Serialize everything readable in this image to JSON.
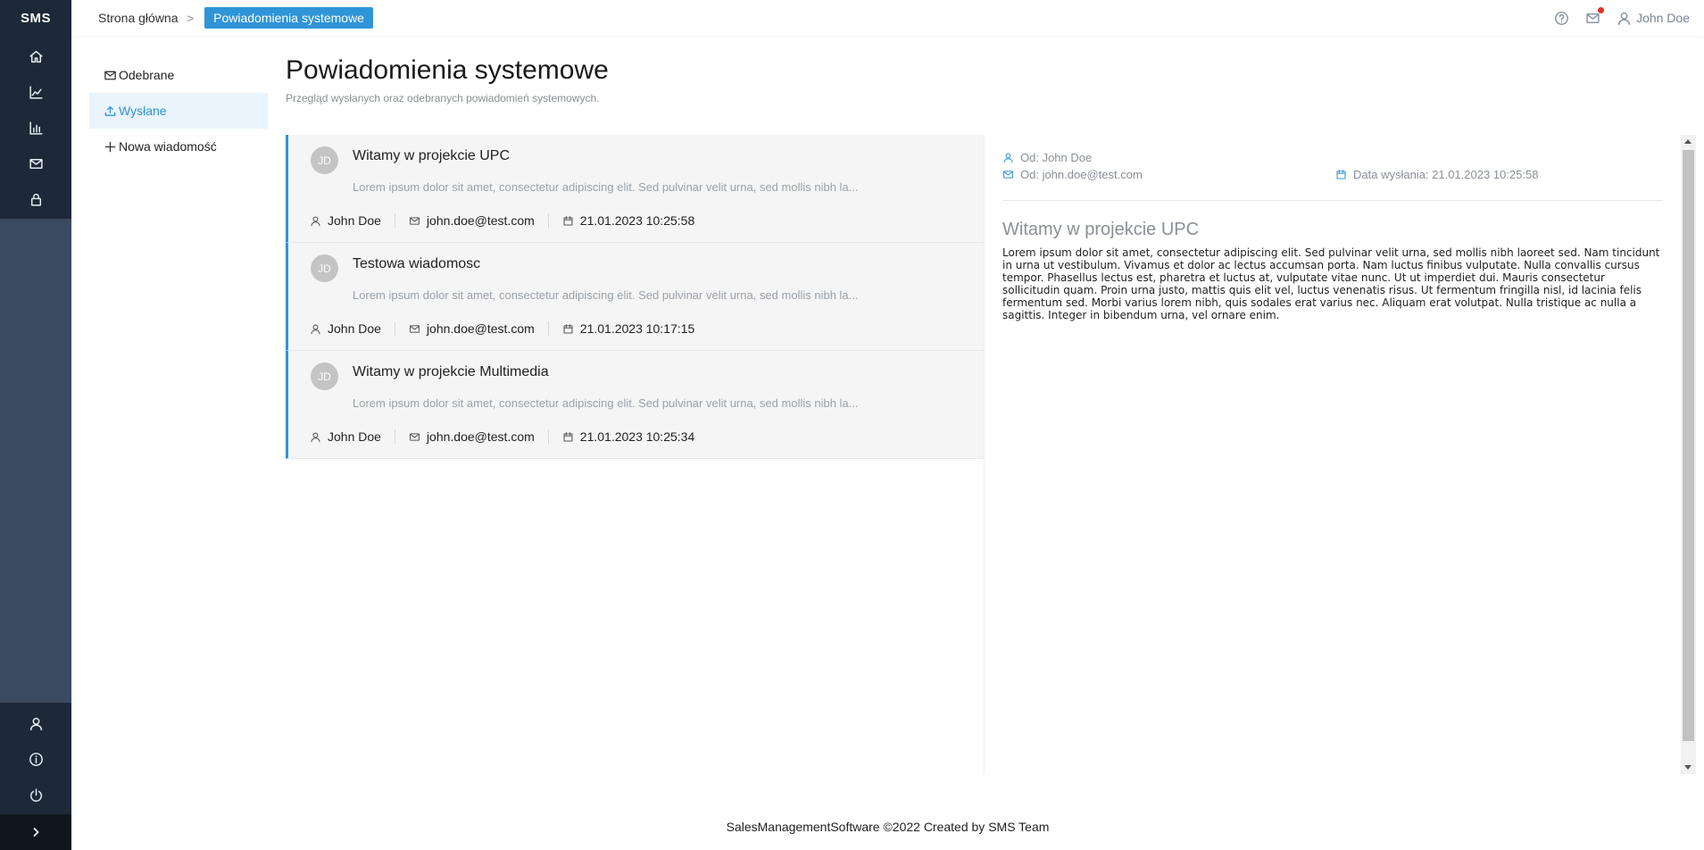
{
  "app": {
    "logo": "SMS"
  },
  "sidebar": {
    "top_icons": [
      "home-icon",
      "line-chart-icon",
      "bar-chart-icon",
      "mail-icon",
      "lock-icon"
    ],
    "bottom_icons": [
      "user-icon",
      "info-icon",
      "power-icon"
    ],
    "expand_icon": "chevron-right-icon"
  },
  "header": {
    "breadcrumb_home": "Strona główna",
    "breadcrumb_separator": ">",
    "breadcrumb_current": "Powiadomienia systemowe",
    "user_name": "John Doe",
    "notification_dot_color": "#e5302a"
  },
  "submenu": {
    "items": [
      {
        "label": "Odebrane",
        "icon": "inbox-icon",
        "active": false
      },
      {
        "label": "Wysłane",
        "icon": "upload-icon",
        "active": true
      },
      {
        "label": "Nowa wiadomość",
        "icon": "plus-icon",
        "active": false
      }
    ]
  },
  "page": {
    "title": "Powiadomienia systemowe",
    "subtitle": "Przegląd wysłanych oraz odebranych powiadomień systemowych."
  },
  "messages": [
    {
      "initials": "JD",
      "title": "Witamy w projekcie UPC",
      "preview": "Lorem ipsum dolor sit amet, consectetur adipiscing elit. Sed pulvinar velit urna, sed mollis nibh la...",
      "author": "John Doe",
      "email": "john.doe@test.com",
      "date": "21.01.2023 10:25:58"
    },
    {
      "initials": "JD",
      "title": "Testowa wiadomosc",
      "preview": "Lorem ipsum dolor sit amet, consectetur adipiscing elit. Sed pulvinar velit urna, sed mollis nibh la...",
      "author": "John Doe",
      "email": "john.doe@test.com",
      "date": "21.01.2023 10:17:15"
    },
    {
      "initials": "JD",
      "title": "Witamy w projekcie Multimedia",
      "preview": "Lorem ipsum dolor sit amet, consectetur adipiscing elit. Sed pulvinar velit urna, sed mollis nibh la...",
      "author": "John Doe",
      "email": "john.doe@test.com",
      "date": "21.01.2023 10:25:34"
    }
  ],
  "detail": {
    "from_name": "Od: John Doe",
    "from_email": "Od: john.doe@test.com",
    "sent_date": "Data wysłania: 21.01.2023 10:25:58",
    "title": "Witamy w projekcie UPC",
    "body": "Lorem ipsum dolor sit amet, consectetur adipiscing elit. Sed pulvinar velit urna, sed mollis nibh laoreet sed. Nam tincidunt in urna ut vestibulum. Vivamus et dolor ac lectus accumsan porta. Nam luctus finibus vulputate. Nulla convallis cursus tempor. Phasellus lectus est, pharetra et luctus at, vulputate vitae nunc. Ut ut imperdiet dui. Mauris consectetur sollicitudin quam. Proin urna justo, mattis quis elit vel, luctus venenatis risus. Ut fermentum fringilla nisl, id lacinia felis fermentum sed. Morbi varius lorem nibh, quis sodales erat varius nec. Aliquam erat volutpat. Nulla tristique ac nulla a sagittis. Integer in bibendum urna, vel ornare enim."
  },
  "footer": {
    "text": "SalesManagementSoftware ©2022 Created by SMS Team"
  },
  "colors": {
    "accent": "#2f94d8",
    "sidebar_dark": "#1d2938",
    "sidebar_mid": "#3a4a5f",
    "message_bg": "#f5f5f5"
  }
}
